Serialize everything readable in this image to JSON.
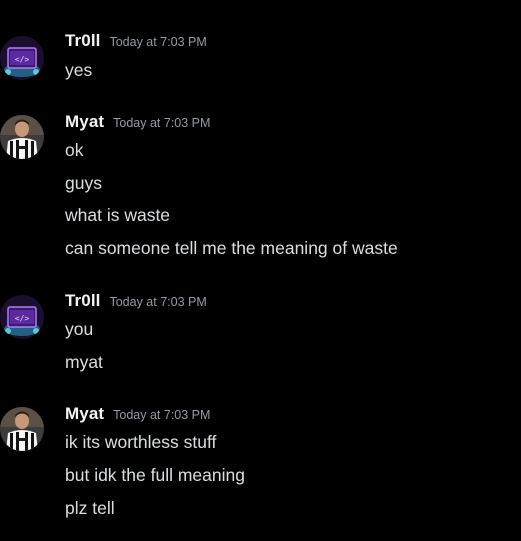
{
  "colors": {
    "background": "#000000",
    "username": "#f2f3f5",
    "timestamp": "#949ba4",
    "message_text": "#dbdee1",
    "troll_avatar_accent": "#9b5cf6",
    "troll_avatar_glow": "#5fd3e8"
  },
  "messages": [
    {
      "author": "Tr0ll",
      "timestamp": "Today at 7:03 PM",
      "avatar_icon": "neon-code-screen-icon",
      "lines": [
        "yes"
      ]
    },
    {
      "author": "Myat",
      "timestamp": "Today at 7:03 PM",
      "avatar_icon": "footballer-photo-icon",
      "lines": [
        "ok",
        "guys",
        "what is waste",
        "can someone tell me the meaning of waste"
      ]
    },
    {
      "author": "Tr0ll",
      "timestamp": "Today at 7:03 PM",
      "avatar_icon": "neon-code-screen-icon",
      "lines": [
        "you",
        "myat"
      ]
    },
    {
      "author": "Myat",
      "timestamp": "Today at 7:03 PM",
      "avatar_icon": "footballer-photo-icon",
      "lines": [
        "ik its worthless stuff",
        "but idk the full meaning",
        "plz tell"
      ]
    }
  ]
}
